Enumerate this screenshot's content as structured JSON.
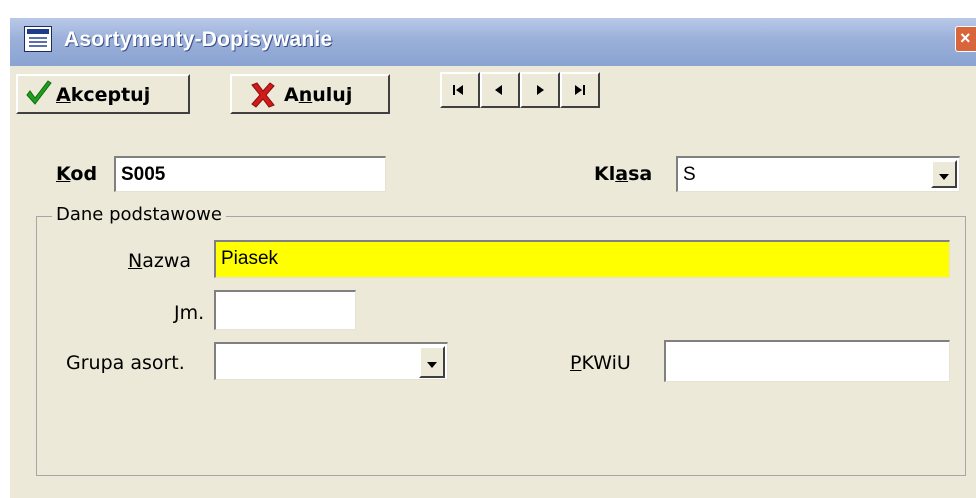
{
  "window": {
    "title": "Asortymenty-Dopisywanie",
    "close_label": "×"
  },
  "toolbar": {
    "accept_label": "kceptuj",
    "accept_key": "A",
    "cancel_pre": "A",
    "cancel_key": "n",
    "cancel_post": "uluj",
    "nav": [
      {
        "icon": "first-record-icon",
        "glyph": "|◀"
      },
      {
        "icon": "prev-record-icon",
        "glyph": "◀"
      },
      {
        "icon": "next-record-icon",
        "glyph": "▶"
      },
      {
        "icon": "last-record-icon",
        "glyph": "▶|"
      }
    ]
  },
  "form": {
    "kod_key": "K",
    "kod_rest": "od",
    "kod_value": "S005",
    "klasa_pre": "Kl",
    "klasa_key": "a",
    "klasa_post": "sa",
    "klasa_value": "S",
    "group_title": "Dane podstawowe",
    "nazwa_key": "N",
    "nazwa_rest": "azwa",
    "nazwa_value": "Piasek",
    "jm_key": "J",
    "jm_rest": "m.",
    "jm_value": "",
    "grupa_label": "Grupa asort.",
    "grupa_value": "",
    "pkwiu_key": "P",
    "pkwiu_rest": "KWiU",
    "pkwiu_value": ""
  },
  "colors": {
    "window_bg": "#ece9d8",
    "highlight_field": "#ffff00",
    "accept_check": "#1f9e1f",
    "cancel_x": "#d11b1b"
  }
}
